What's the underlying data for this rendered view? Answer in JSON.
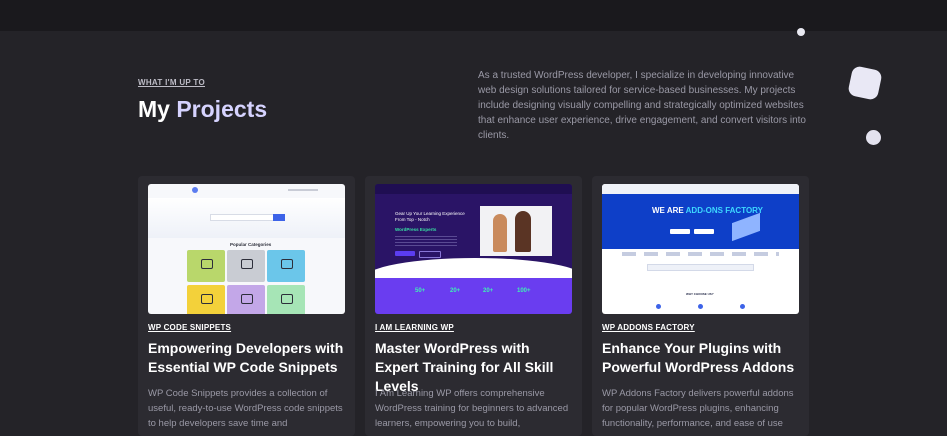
{
  "section": {
    "eyebrow": "WHAT I'M UP TO",
    "title_part1": "My",
    "title_part2": "Projects",
    "intro": "As a trusted WordPress developer, I specialize in developing innovative web design solutions tailored for service-based businesses. My projects include designing visually compelling and strategically optimized websites that enhance user experience, drive engagement, and convert visitors into clients."
  },
  "projects": [
    {
      "tag": "WP CODE SNIPPETS",
      "title": "Empowering Developers with Essential WP Code Snippets",
      "description": "WP Code Snippets provides a collection of useful, ready-to-use WordPress code snippets to help developers save time and",
      "thumb": {
        "categories_title": "Popular Categories"
      }
    },
    {
      "tag": "I AM LEARNING WP",
      "title": "Master WordPress with Expert Training for All Skill Levels",
      "description": "I Am Learning WP offers comprehensive WordPress training for beginners to advanced learners, empowering you to build,",
      "thumb": {
        "headline": "Gear Up Your Learning Experience From Top - Notch",
        "highlight": "WordPress Experts",
        "stats": [
          "50+",
          "20+",
          "20+",
          "100+"
        ]
      }
    },
    {
      "tag": "WP ADDONS FACTORY",
      "title": "Enhance Your Plugins with Powerful WordPress Addons",
      "description": "WP Addons Factory delivers powerful addons for popular WordPress plugins, enhancing functionality, performance, and ease of use",
      "thumb": {
        "headline_a": "WE ARE",
        "headline_b": "ADD-ONS FACTORY",
        "section_label": "WHY CHOOSE US?"
      }
    }
  ],
  "colors": {
    "background": "#242328",
    "card": "#2c2b31",
    "accent": "#d6d3ff"
  }
}
